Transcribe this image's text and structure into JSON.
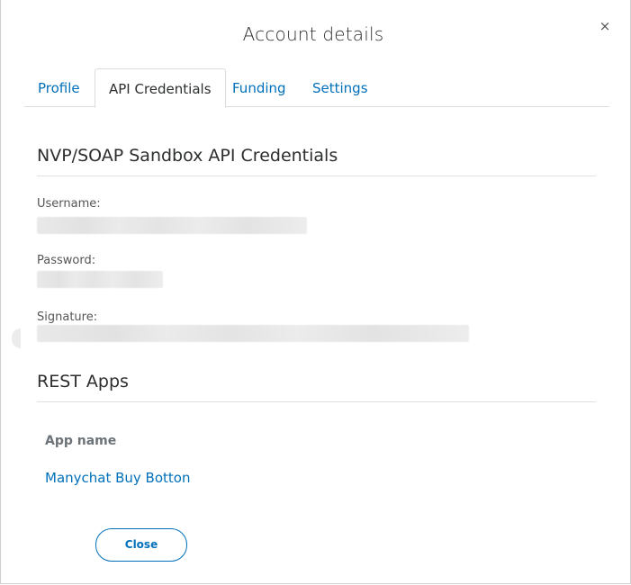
{
  "modal": {
    "title": "Account details",
    "close_glyph": "×"
  },
  "tabs": [
    {
      "label": "Profile",
      "active": false
    },
    {
      "label": "API Credentials",
      "active": true
    },
    {
      "label": "Funding",
      "active": false
    },
    {
      "label": "Settings",
      "active": false
    }
  ],
  "credentials": {
    "heading": "NVP/SOAP Sandbox API Credentials",
    "username_label": "Username:",
    "password_label": "Password:",
    "signature_label": "Signature:"
  },
  "rest_apps": {
    "heading": "REST Apps",
    "column_header": "App name",
    "apps": [
      "Manychat Buy Botton"
    ]
  },
  "footer": {
    "close_label": "Close"
  },
  "colors": {
    "link": "#0070ba",
    "text": "#2c2e2f",
    "border": "#dcdcdc"
  }
}
